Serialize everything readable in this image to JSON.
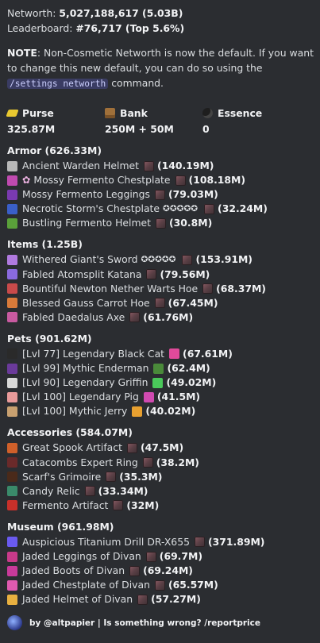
{
  "header": {
    "networth_label": "Networth:",
    "networth_value": "5,027,188,617 (5.03B)",
    "leaderboard_label": "Leaderboard:",
    "leaderboard_value": "#76,717 (Top 5.6%)"
  },
  "note": {
    "label": "NOTE",
    "text1": ": Non-Cosmetic Networth is now the default. If you want to change this new default, you can do so using the ",
    "command": "/settings networth",
    "text2": " command."
  },
  "fields": {
    "purse_label": "Purse",
    "purse_value": "325.87M",
    "purse_icon": "gold-ingot-icon",
    "bank_label": "Bank",
    "bank_value": "250M + 50M",
    "bank_icon": "chest-icon",
    "essence_label": "Essence",
    "essence_value": "0",
    "essence_icon": "wither-essence-icon"
  },
  "sections": [
    {
      "title": "Armor (626.33M)",
      "items": [
        {
          "name": "Ancient Warden Helmet",
          "value": "(140.19M)",
          "icon_color": "#b8b8b8",
          "icon": "skull-helmet-icon"
        },
        {
          "name": "Mossy Fermento Chestplate",
          "value": "(108.18M)",
          "icon_color": "#c04ab0",
          "icon": "chestplate-icon",
          "prefix": "✿"
        },
        {
          "name": "Mossy Fermento Leggings",
          "value": "(79.03M)",
          "icon_color": "#7a3ab0",
          "icon": "leggings-icon"
        },
        {
          "name": "Necrotic Storm's Chestplate",
          "value": "(32.24M)",
          "icon_color": "#3a5fc8",
          "icon": "chestplate-icon",
          "stars": "✪✪✪✪✪"
        },
        {
          "name": "Bustling Fermento Helmet",
          "value": "(30.8M)",
          "icon_color": "#5aa03a",
          "icon": "helmet-icon"
        }
      ]
    },
    {
      "title": "Items (1.25B)",
      "items": [
        {
          "name": "Withered Giant's Sword",
          "value": "(153.91M)",
          "icon_color": "#b07adf",
          "icon": "sword-icon",
          "stars": "✪✪✪✪✪"
        },
        {
          "name": "Fabled Atomsplit Katana",
          "value": "(79.56M)",
          "icon_color": "#8a6adf",
          "icon": "katana-icon"
        },
        {
          "name": "Bountiful Newton Nether Warts Hoe",
          "value": "(68.37M)",
          "icon_color": "#c84a4a",
          "icon": "hoe-icon"
        },
        {
          "name": "Blessed Gauss Carrot Hoe",
          "value": "(67.45M)",
          "icon_color": "#d87a3a",
          "icon": "hoe-icon"
        },
        {
          "name": "Fabled Daedalus Axe",
          "value": "(61.76M)",
          "icon_color": "#c85aa0",
          "icon": "axe-icon"
        }
      ]
    },
    {
      "title": "Pets (901.62M)",
      "items": [
        {
          "name": "[Lvl 77] Legendary Black Cat",
          "value": "(67.61M)",
          "icon_color": "#2a2a2a",
          "icon": "black-cat-icon",
          "tail_icon": "#e04a9a",
          "tail_name": "pet-item-icon"
        },
        {
          "name": "[Lvl 99] Mythic Enderman",
          "value": "(62.4M)",
          "icon_color": "#6a3a9a",
          "icon": "enderman-icon",
          "tail_icon": "#4a8a3a",
          "tail_name": "pet-item-icon"
        },
        {
          "name": "[Lvl 90] Legendary Griffin",
          "value": "(49.02M)",
          "icon_color": "#d8d8d8",
          "icon": "griffin-icon",
          "tail_icon": "#4ac85a",
          "tail_name": "clover-icon"
        },
        {
          "name": "[Lvl 100] Legendary Pig",
          "value": "(41.5M)",
          "icon_color": "#e89a9a",
          "icon": "pig-icon",
          "tail_icon": "#d04ab0",
          "tail_name": "pet-item-icon"
        },
        {
          "name": "[Lvl 100] Mythic Jerry",
          "value": "(40.02M)",
          "icon_color": "#c8a070",
          "icon": "jerry-icon",
          "tail_icon": "#e8a030",
          "tail_name": "pet-item-icon"
        }
      ]
    },
    {
      "title": "Accessories (584.07M)",
      "items": [
        {
          "name": "Great Spook Artifact",
          "value": "(47.5M)",
          "icon_color": "#d0602a",
          "icon": "spook-artifact-icon"
        },
        {
          "name": "Catacombs Expert Ring",
          "value": "(38.2M)",
          "icon_color": "#6a2a2a",
          "icon": "ring-icon"
        },
        {
          "name": "Scarf's Grimoire",
          "value": "(35.3M)",
          "icon_color": "#4a2a1a",
          "icon": "grimoire-icon"
        },
        {
          "name": "Candy Relic",
          "value": "(33.34M)",
          "icon_color": "#3a8a6a",
          "icon": "candy-relic-icon"
        },
        {
          "name": "Fermento Artifact",
          "value": "(32M)",
          "icon_color": "#c8302a",
          "icon": "fermento-artifact-icon"
        }
      ]
    },
    {
      "title": "Museum (961.98M)",
      "items": [
        {
          "name": "Auspicious Titanium Drill DR-X655",
          "value": "(371.89M)",
          "icon_color": "#6a5aef",
          "icon": "drill-icon"
        },
        {
          "name": "Jaded Leggings of Divan",
          "value": "(69.7M)",
          "icon_color": "#c83a8a",
          "icon": "leggings-icon"
        },
        {
          "name": "Jaded Boots of Divan",
          "value": "(69.24M)",
          "icon_color": "#c83a9a",
          "icon": "boots-icon"
        },
        {
          "name": "Jaded Chestplate of Divan",
          "value": "(65.57M)",
          "icon_color": "#e05ab0",
          "icon": "chestplate-icon"
        },
        {
          "name": "Jaded Helmet of Divan",
          "value": "(57.27M)",
          "icon_color": "#e8b040",
          "icon": "helmet-icon"
        }
      ]
    }
  ],
  "footer": {
    "text": "by @altpapier | Is something wrong? /reportprice",
    "avatar_icon": "author-avatar-icon"
  }
}
